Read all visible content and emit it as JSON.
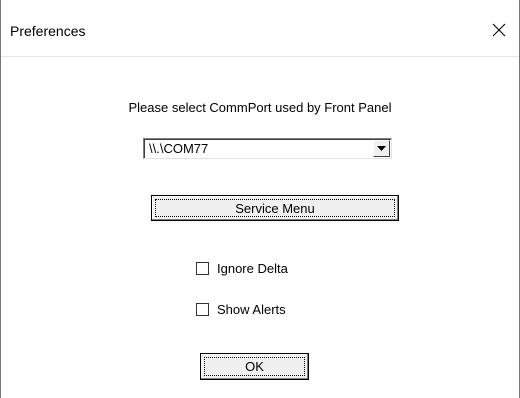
{
  "window": {
    "title": "Preferences",
    "close_icon": "close-icon"
  },
  "dialog": {
    "prompt": "Please select CommPort used by Front Panel",
    "commport": {
      "selected": "\\\\.\\COM77",
      "arrow_icon": "dropdown-arrow-icon"
    },
    "service_menu_label": "Service Menu",
    "ignore_delta": {
      "label": "Ignore Delta",
      "checked": false
    },
    "show_alerts": {
      "label": "Show Alerts",
      "checked": false
    },
    "ok_label": "OK"
  }
}
